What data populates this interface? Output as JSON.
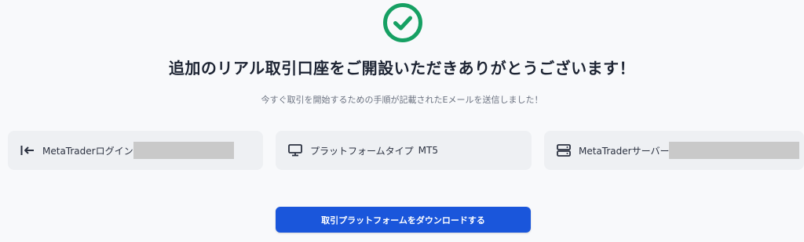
{
  "status": {
    "icon": "check-circle-icon",
    "color": "#16a063"
  },
  "headline": "追加のリアル取引口座をご開設いただきありがとうございます！",
  "subtext": "今すぐ取引を開始するための手順が記載されたEメールを送信しました！",
  "info_cards": [
    {
      "icon": "login-arrow-icon",
      "label": "MetaTraderログイン",
      "value_redacted": true
    },
    {
      "icon": "monitor-icon",
      "label": "プラットフォームタイプ",
      "value": "MT5"
    },
    {
      "icon": "server-icon",
      "label": "MetaTraderサーバー",
      "value_redacted": true
    }
  ],
  "download_button": {
    "label": "取引プラットフォームをダウンロードする",
    "color": "#1a56db"
  }
}
